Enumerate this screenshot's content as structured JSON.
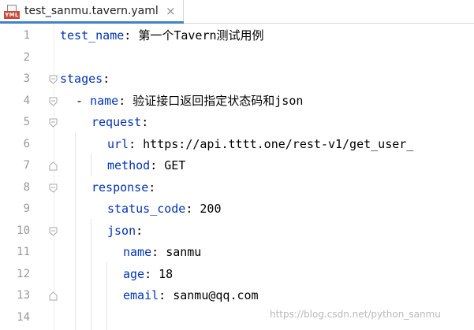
{
  "tab": {
    "icon_label": "YML",
    "filename": "test_sanmu.tavern.yaml",
    "close_glyph": "×",
    "accent_color": "#4083c9"
  },
  "editor": {
    "lines": [
      {
        "num": "1",
        "key": "test_name",
        "sep": ": ",
        "value": "第一个Tavern测试用例"
      },
      {
        "num": "2",
        "key": "",
        "sep": "",
        "value": ""
      },
      {
        "num": "3",
        "key": "stages",
        "sep": ":",
        "value": ""
      },
      {
        "num": "4",
        "dash": "- ",
        "key": "name",
        "sep": ": ",
        "value": "验证接口返回指定状态码和json"
      },
      {
        "num": "5",
        "key": "request",
        "sep": ":",
        "value": ""
      },
      {
        "num": "6",
        "key": "url",
        "sep": ": ",
        "value": "https://api.tttt.one/rest-v1/get_user_"
      },
      {
        "num": "7",
        "key": "method",
        "sep": ": ",
        "value": "GET"
      },
      {
        "num": "8",
        "key": "response",
        "sep": ":",
        "value": ""
      },
      {
        "num": "9",
        "key": "status_code",
        "sep": ": ",
        "value": "200"
      },
      {
        "num": "10",
        "key": "json",
        "sep": ":",
        "value": ""
      },
      {
        "num": "11",
        "key": "name",
        "sep": ": ",
        "value": "sanmu"
      },
      {
        "num": "12",
        "key": "age",
        "sep": ": ",
        "value": "18"
      },
      {
        "num": "13",
        "key": "email",
        "sep": ": ",
        "value": "sanmu@qq.com"
      },
      {
        "num": "14",
        "key": "",
        "sep": "",
        "value": ""
      }
    ]
  },
  "watermark": "https://blog.csdn.net/python_sanmu",
  "colors": {
    "key": "#0033b3",
    "line_number": "#999999",
    "gutter_separator": "#ededed"
  }
}
